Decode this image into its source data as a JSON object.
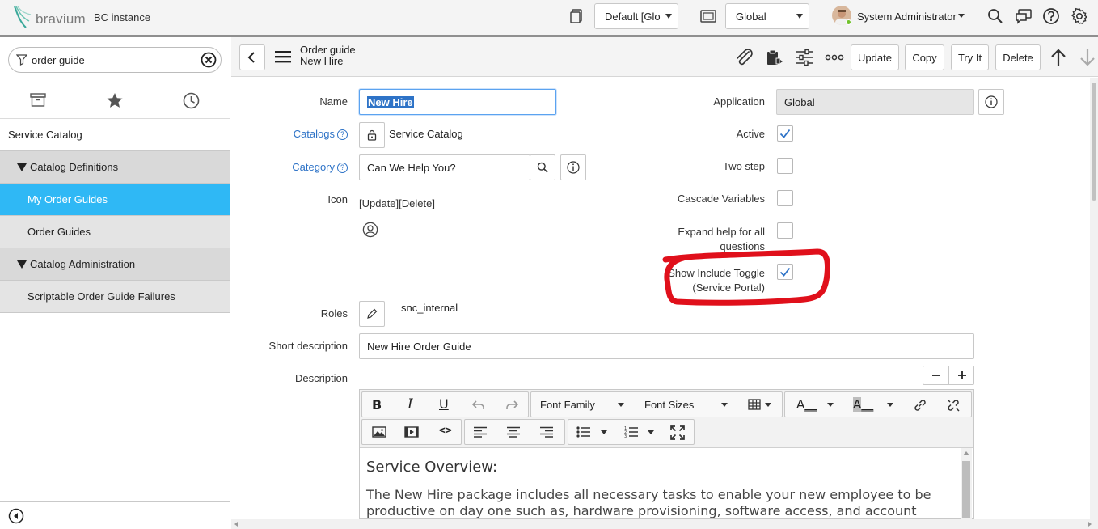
{
  "topbar": {
    "brand_name": "bravium",
    "instance_label": "BC instance",
    "update_set_value": "Default [Glo",
    "scope_value": "Global",
    "user_name": "System Administrator"
  },
  "nav": {
    "filter_value": "order guide",
    "tabs": [
      "all-apps-icon",
      "favorites-star-icon",
      "history-clock-icon"
    ],
    "items": [
      {
        "label": "Service Catalog",
        "level": 0,
        "state": "plain"
      },
      {
        "label": "Catalog Definitions",
        "level": 1,
        "state": "expanded"
      },
      {
        "label": "My Order Guides",
        "level": 2,
        "state": "selected"
      },
      {
        "label": "Order Guides",
        "level": 2,
        "state": "normal"
      },
      {
        "label": "Catalog Administration",
        "level": 1,
        "state": "expanded"
      },
      {
        "label": "Scriptable Order Guide Failures",
        "level": 2,
        "state": "normal"
      }
    ]
  },
  "header": {
    "table_name": "Order guide",
    "record_name": "New Hire",
    "buttons": {
      "update": "Update",
      "copy": "Copy",
      "try_it": "Try It",
      "delete": "Delete"
    }
  },
  "form": {
    "name_label": "Name",
    "name_value": "New Hire",
    "catalogs_label": "Catalogs",
    "catalogs_value": "Service Catalog",
    "category_label": "Category",
    "category_value": "Can We Help You?",
    "icon_label": "Icon",
    "icon_links": "[Update][Delete]",
    "roles_label": "Roles",
    "roles_value": "snc_internal",
    "short_desc_label": "Short description",
    "short_desc_value": "New Hire Order Guide",
    "description_label": "Description",
    "application_label": "Application",
    "application_value": "Global",
    "active_label": "Active",
    "active_checked": true,
    "two_step_label": "Two step",
    "two_step_checked": false,
    "cascade_label": "Cascade Variables",
    "cascade_checked": false,
    "expand_help_label_1": "Expand help for all",
    "expand_help_label_2": "questions",
    "expand_help_checked": false,
    "show_toggle_label_1": "Show Include Toggle",
    "show_toggle_label_2": "(Service Portal)",
    "show_toggle_checked": true
  },
  "editor": {
    "font_family_label": "Font Family",
    "font_sizes_label": "Font Sizes",
    "heading": "Service Overview:",
    "body_line_1": "The New Hire package includes all necessary tasks to enable your new employee to be",
    "body_line_2": "productive on day one such as, hardware provisioning, software access, and account"
  },
  "colors": {
    "accent_blue": "#2e73c7",
    "selected_nav": "#2fb8f5",
    "annotation_red": "#e0101b",
    "checkbox_blue": "#2e73c7"
  }
}
